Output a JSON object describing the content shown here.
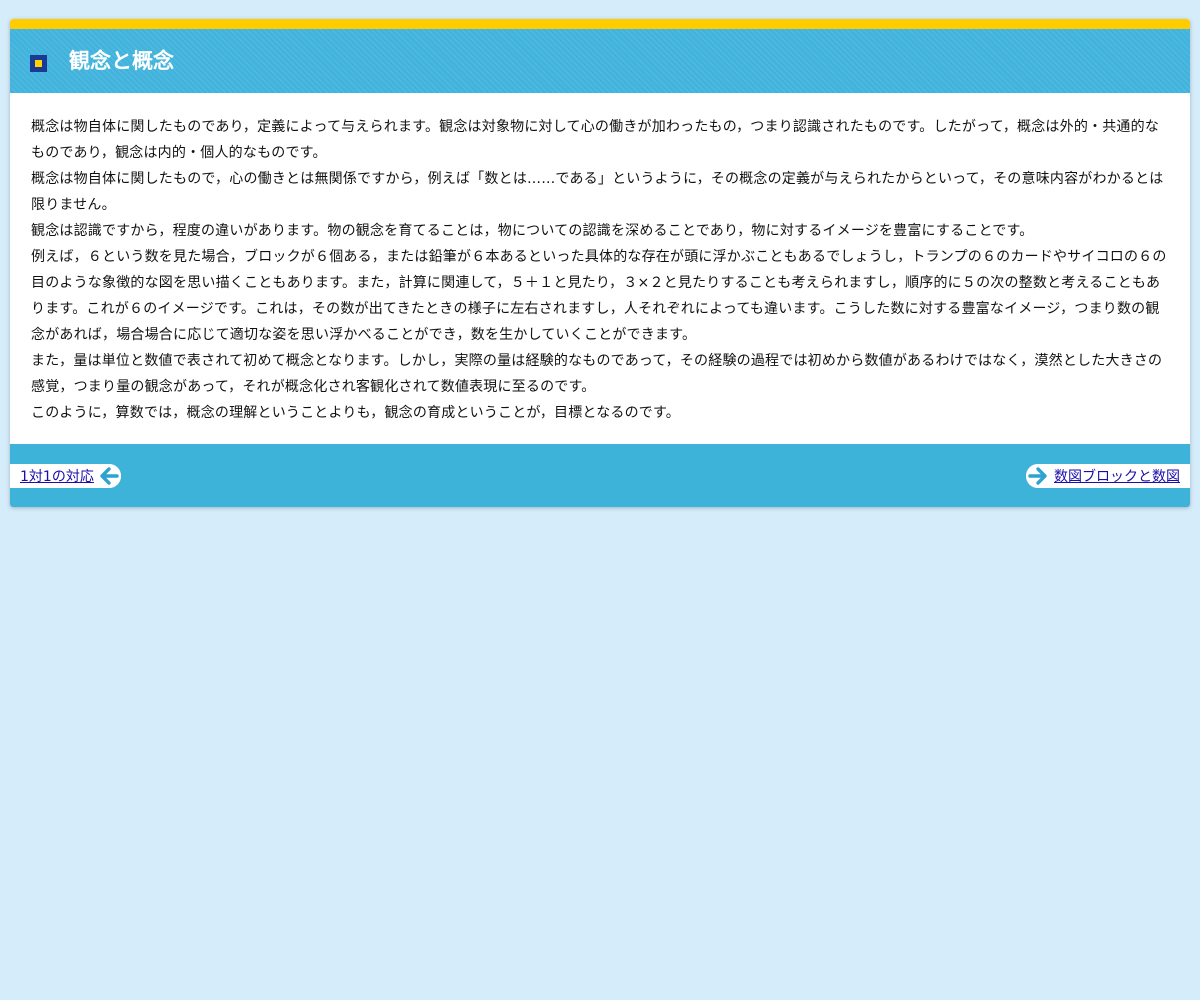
{
  "header": {
    "title": "観念と概念"
  },
  "content": {
    "paragraphs": [
      "概念は物自体に関したものであり，定義によって与えられます。観念は対象物に対して心の働きが加わったもの，つまり認識されたものです。したがって，概念は外的・共通的なものであり，観念は内的・個人的なものです。",
      "概念は物自体に関したもので，心の働きとは無関係ですから，例えば「数とは……である」というように，その概念の定義が与えられたからといって，その意味内容がわかるとは限りません。",
      "観念は認識ですから，程度の違いがあります。物の観念を育てることは，物についての認識を深めることであり，物に対するイメージを豊富にすることです。",
      "例えば，６という数を見た場合，ブロックが６個ある，または鉛筆が６本あるといった具体的な存在が頭に浮かぶこともあるでしょうし，トランプの６のカードやサイコロの６の目のような象徴的な図を思い描くこともあります。また，計算に関連して，５＋１と見たり，３×２と見たりすることも考えられますし，順序的に５の次の整数と考えることもあります。これが６のイメージです。これは，その数が出てきたときの様子に左右されますし，人それぞれによっても違います。こうした数に対する豊富なイメージ，つまり数の観念があれば，場合場合に応じて適切な姿を思い浮かべることができ，数を生かしていくことができます。",
      "また，量は単位と数値で表されて初めて概念となります。しかし，実際の量は経験的なものであって，その経験の過程では初めから数値があるわけではなく，漠然とした大きさの感覚，つまり量の観念があって，それが概念化され客観化されて数値表現に至るのです。",
      "このように，算数では，概念の理解ということよりも，観念の育成ということが，目標となるのです。"
    ]
  },
  "footer": {
    "prev_label": "1対1の対応",
    "next_label": "数図ブロックと数図"
  },
  "icons": {
    "header": "square-bullet-icon",
    "prev": "arrow-left-icon",
    "next": "arrow-right-icon"
  },
  "colors": {
    "page_background": "#d5edfb",
    "accent_yellow": "#ffcc00",
    "header_blue": "#41b3dc",
    "footer_blue": "#3eb3da",
    "link": "#1a0dab",
    "icon_navy": "#1b3a93"
  }
}
